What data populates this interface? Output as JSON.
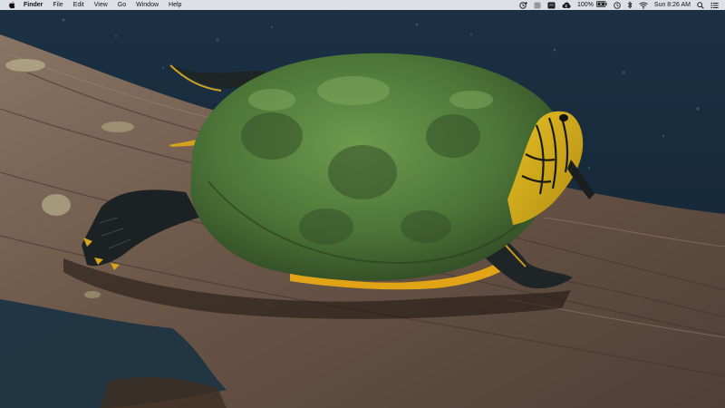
{
  "menubar": {
    "app_name": "Finder",
    "menus": [
      "File",
      "Edit",
      "View",
      "Go",
      "Window",
      "Help"
    ],
    "battery_percent": "100%",
    "clock": "Sun 8:26 AM",
    "status_icons": [
      "activity-icon",
      "gray-square-icon",
      "screen-icon",
      "creative-cloud-icon",
      "time-machine-icon",
      "bluetooth-icon",
      "wifi-icon",
      "search-icon",
      "notification-center-icon"
    ]
  },
  "wallpaper": {
    "subject": "turtle-on-log",
    "colors": {
      "water": "#17293b",
      "log": "#6e5a4c",
      "shell_moss": "#4f7a3a",
      "head_yellow": "#d9b21e"
    }
  }
}
